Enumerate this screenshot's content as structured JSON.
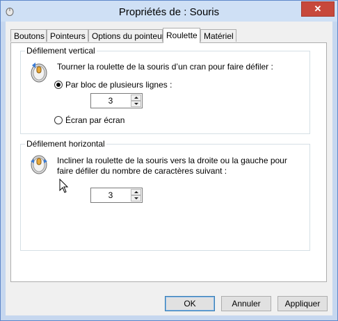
{
  "window": {
    "title": "Propriétés de : Souris",
    "close_symbol": "✕"
  },
  "tabs": [
    "Boutons",
    "Pointeurs",
    "Options du pointeur",
    "Roulette",
    "Matériel"
  ],
  "active_tab": "Roulette",
  "vertical": {
    "legend": "Défilement vertical",
    "description": "Tourner la roulette de la souris d’un cran pour faire défiler :",
    "option_lines": "Par bloc de plusieurs lignes :",
    "option_lines_selected": true,
    "lines_value": "3",
    "option_screen": "Écran par écran",
    "option_screen_selected": false
  },
  "horizontal": {
    "legend": "Défilement horizontal",
    "description": "Incliner la roulette de la souris vers la droite ou la gauche pour faire défiler du nombre de caractères suivant :",
    "chars_value": "3"
  },
  "buttons": {
    "ok": "OK",
    "cancel": "Annuler",
    "apply": "Appliquer"
  },
  "icons": {
    "app": "mouse-icon",
    "wheel": "mouse-wheel-icon",
    "cursor": "arrow-cursor-icon"
  }
}
